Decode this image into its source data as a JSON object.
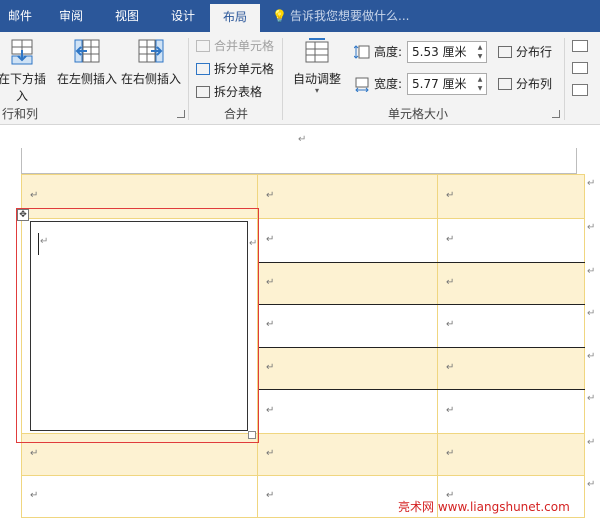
{
  "tabs": [
    {
      "label": "邮件",
      "active": false
    },
    {
      "label": "审阅",
      "active": false
    },
    {
      "label": "视图",
      "active": false
    },
    {
      "label": "设计",
      "active": false
    },
    {
      "label": "布局",
      "active": true
    }
  ],
  "tell_me": {
    "placeholder": "告诉我您想要做什么..."
  },
  "ribbon": {
    "rows_cols": {
      "insert_below": "在下方插入",
      "insert_left": "在左侧插入",
      "insert_right": "在右侧插入",
      "group_label": "行和列"
    },
    "merge": {
      "merge_cells": "合并单元格",
      "split_cells": "拆分单元格",
      "split_table": "拆分表格",
      "group_label": "合并"
    },
    "cell_size": {
      "autofit": "自动调整",
      "height_label": "高度:",
      "height_value": "5.53 厘米",
      "width_label": "宽度:",
      "width_value": "5.77 厘米",
      "distribute_rows": "分布行",
      "distribute_cols": "分布列",
      "group_label": "单元格大小"
    }
  },
  "document": {
    "paragraph_mark": "↵"
  },
  "watermark": "亮术网 www.liangshunet.com",
  "colors": {
    "tab_bar": "#2b579a",
    "ribbon_bg": "#f3f3f3",
    "cell_shade": "#fdf2d2",
    "cell_border": "#f0d680",
    "selection_border": "#e03c3c",
    "watermark": "#d42222"
  }
}
